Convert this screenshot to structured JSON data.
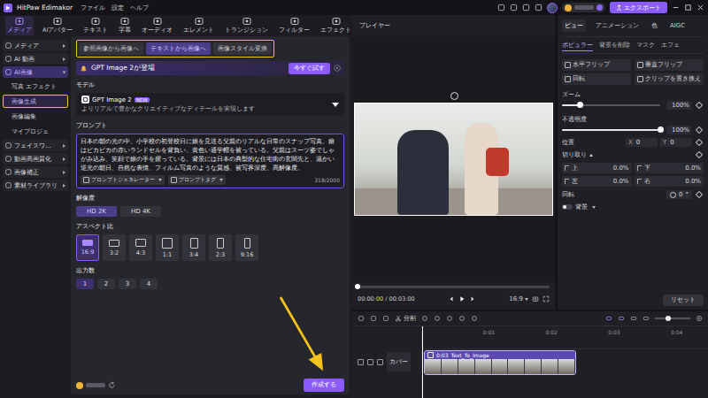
{
  "titlebar": {
    "app_name": "HitPaw Edimakor",
    "menu": [
      "ファイル",
      "設定",
      "ヘルプ"
    ],
    "export_button": "エクスポート"
  },
  "toolbar": [
    {
      "label": "メディア",
      "selected": true
    },
    {
      "label": "AIアバター",
      "selected": false
    },
    {
      "label": "テキスト",
      "selected": false
    },
    {
      "label": "字幕",
      "selected": false
    },
    {
      "label": "オーディオ",
      "selected": false
    },
    {
      "label": "エレメント",
      "selected": false
    },
    {
      "label": "トランジション",
      "selected": false
    },
    {
      "label": "フィルター",
      "selected": false
    },
    {
      "label": "エフェクト",
      "selected": false
    }
  ],
  "sidebar": [
    {
      "label": "メディア",
      "expanded": false,
      "selected": false,
      "children": []
    },
    {
      "label": "AI 動画",
      "expanded": false,
      "selected": false,
      "children": []
    },
    {
      "label": "AI画像",
      "expanded": true,
      "selected": true,
      "children": [
        {
          "label": "写真 エフェクト",
          "selected": false
        },
        {
          "label": "画像生成",
          "selected": true
        },
        {
          "label": "画像編集",
          "selected": false
        },
        {
          "label": "マイプロジェ",
          "selected": false
        }
      ]
    },
    {
      "label": "フェイスワ...",
      "expanded": false,
      "selected": false,
      "children": []
    },
    {
      "label": "動画高画質化",
      "expanded": false,
      "selected": false,
      "children": []
    },
    {
      "label": "画像補正",
      "expanded": false,
      "selected": false,
      "children": []
    },
    {
      "label": "素材ライブラリ",
      "expanded": false,
      "selected": false,
      "children": []
    }
  ],
  "generator": {
    "tabs": [
      {
        "label": "参照画像から画像へ",
        "selected": false
      },
      {
        "label": "テキストから画像へ",
        "selected": true
      },
      {
        "label": "画像スタイル変換",
        "selected": false
      }
    ],
    "banner": {
      "title": "GPT Image 2が登場",
      "button": "今すぐ試す"
    },
    "model": {
      "section": "モデル",
      "name": "GPT Image 2",
      "badge": "NEW",
      "description": "よりリアルで豊かなクリエイティブなディテールを実現します"
    },
    "prompt": {
      "section": "プロンプト",
      "text": "日本の朝の光の中、小学校の初登校日に娘を見送る父親のリアルな日常のスナップ写真。娘はピカピカの赤いランドセルを背負い、黄色い通学帽を被っている。父親はスーツ姿でしゃがみ込み、笑顔で娘の手を握っている。背景には日本の典型的な住宅街の玄関先と、温かい逆光の朝日、自然な表情、フィルム写真のような質感、被写界深度、高解像度。",
      "tools": [
        "プロンプトジェネレーター",
        "プロンプトタグ"
      ],
      "counter": "318/2000"
    },
    "resolution": {
      "section": "解像度",
      "options": [
        {
          "label": "HD 2K",
          "selected": true
        },
        {
          "label": "HD 4K",
          "selected": false
        }
      ]
    },
    "aspect_ratio": {
      "section": "アスペクト比",
      "options": [
        {
          "label": "16:9",
          "selected": true
        },
        {
          "label": "3:2",
          "selected": false
        },
        {
          "label": "4:3",
          "selected": false
        },
        {
          "label": "1:1",
          "selected": false
        },
        {
          "label": "3:4",
          "selected": false
        },
        {
          "label": "2:3",
          "selected": false
        },
        {
          "label": "9:16",
          "selected": false
        }
      ]
    },
    "output_count": {
      "section": "出力数",
      "options": [
        {
          "label": "1",
          "selected": true
        },
        {
          "label": "2",
          "selected": false
        },
        {
          "label": "3",
          "selected": false
        },
        {
          "label": "4",
          "selected": false
        }
      ]
    },
    "create_button": "作成する"
  },
  "player": {
    "title": "プレイヤー",
    "time": "00:00:00 / 00:03:00",
    "ratio": "16:9",
    "progress": 0
  },
  "properties": {
    "tabs": [
      {
        "label": "ビュー",
        "selected": true
      },
      {
        "label": "アニメーション",
        "selected": false
      },
      {
        "label": "色",
        "selected": false
      },
      {
        "label": "AIGC",
        "selected": false
      }
    ],
    "subtabs": [
      {
        "label": "ポピュラー",
        "selected": true
      },
      {
        "label": "背景を削除",
        "selected": false
      },
      {
        "label": "マスク",
        "selected": false
      },
      {
        "label": "エフェ",
        "selected": false
      }
    ],
    "actions": [
      "水平フリップ",
      "垂直フリップ",
      "回転",
      "クリップを置き換え"
    ],
    "sliders": [
      {
        "label": "ズーム",
        "value": "100%",
        "level": 0.18
      },
      {
        "label": "不透明度",
        "value": "100%",
        "level": 1
      }
    ],
    "position": {
      "label": "位置",
      "x_label": "X",
      "x": "0",
      "y_label": "Y",
      "y": "0"
    },
    "crop": {
      "label": "切り取り",
      "expanded": true,
      "fields": [
        {
          "label": "上",
          "value": "0.0%"
        },
        {
          "label": "下",
          "value": "0.0%"
        },
        {
          "label": "左",
          "value": "0.0%"
        },
        {
          "label": "右",
          "value": "0.0%"
        }
      ]
    },
    "rotation": {
      "label": "回転",
      "value": "0",
      "unit": "°"
    },
    "background": {
      "label": "背景",
      "on": false
    },
    "reset_button": "リセット"
  },
  "timeline": {
    "split_button": "分割",
    "ruler": [
      "0:01",
      "0:02",
      "0:03",
      "0:04"
    ],
    "track_label": "カバー",
    "clip": {
      "duration": "0:03",
      "name": "Text_To_Image"
    }
  }
}
